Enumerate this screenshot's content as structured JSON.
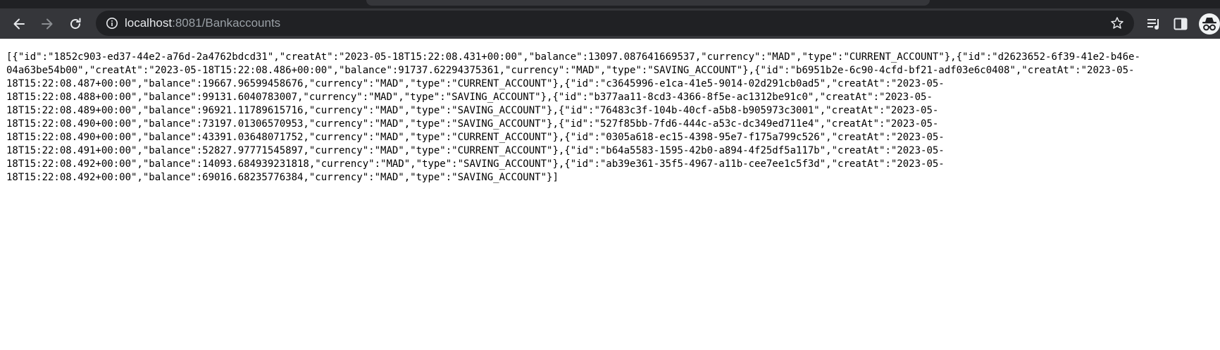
{
  "browser": {
    "url_host": "localhost",
    "url_rest": ":8081/Bankaccounts",
    "icons": {
      "back": "arrow-left-icon",
      "forward": "arrow-right-icon",
      "reload": "reload-icon",
      "site_info": "info-circle-icon",
      "bookmark": "star-icon",
      "media": "media-queue-icon",
      "side_panel": "side-panel-icon",
      "profile": "incognito-icon"
    },
    "colors": {
      "frame": "#202124",
      "toolbar": "#35363a",
      "omnibox": "#202124",
      "url_host": "#e8eaed",
      "url_rest": "#9aa0a6"
    }
  },
  "page": {
    "lines": [
      "[{\"id\":\"1852c903-ed37-44e2-a76d-2a4762bdcd31\",\"creatAt\":\"2023-05-18T15:22:08.431+00:00\",\"balance\":13097.087641669537,\"currency\":\"MAD\",\"type\":\"CURRENT_ACCOUNT\"},{\"id\":\"d2623652-6f39-41e2-b46e-",
      "04a63be54b00\",\"creatAt\":\"2023-05-18T15:22:08.486+00:00\",\"balance\":91737.62294375361,\"currency\":\"MAD\",\"type\":\"SAVING_ACCOUNT\"},{\"id\":\"b6951b2e-6c90-4cfd-bf21-adf03e6c0408\",\"creatAt\":\"2023-05-",
      "18T15:22:08.487+00:00\",\"balance\":19667.96599458676,\"currency\":\"MAD\",\"type\":\"CURRENT_ACCOUNT\"},{\"id\":\"c3645996-e1ca-41e5-9014-02d291cb0ad5\",\"creatAt\":\"2023-05-",
      "18T15:22:08.488+00:00\",\"balance\":99131.6040783007,\"currency\":\"MAD\",\"type\":\"SAVING_ACCOUNT\"},{\"id\":\"b377aa11-8cd3-4366-8f5e-ac1312be91c0\",\"creatAt\":\"2023-05-",
      "18T15:22:08.489+00:00\",\"balance\":96921.11789615716,\"currency\":\"MAD\",\"type\":\"SAVING_ACCOUNT\"},{\"id\":\"76483c3f-104b-40cf-a5b8-b905973c3001\",\"creatAt\":\"2023-05-",
      "18T15:22:08.490+00:00\",\"balance\":73197.01306570953,\"currency\":\"MAD\",\"type\":\"SAVING_ACCOUNT\"},{\"id\":\"527f85bb-7fd6-444c-a53c-dc349ed711e4\",\"creatAt\":\"2023-05-",
      "18T15:22:08.490+00:00\",\"balance\":43391.03648071752,\"currency\":\"MAD\",\"type\":\"CURRENT_ACCOUNT\"},{\"id\":\"0305a618-ec15-4398-95e7-f175a799c526\",\"creatAt\":\"2023-05-",
      "18T15:22:08.491+00:00\",\"balance\":52827.97771545897,\"currency\":\"MAD\",\"type\":\"CURRENT_ACCOUNT\"},{\"id\":\"b64a5583-1595-42b0-a894-4f25df5a117b\",\"creatAt\":\"2023-05-",
      "18T15:22:08.492+00:00\",\"balance\":14093.684939231818,\"currency\":\"MAD\",\"type\":\"SAVING_ACCOUNT\"},{\"id\":\"ab39e361-35f5-4967-a11b-cee7ee1c5f3d\",\"creatAt\":\"2023-05-",
      "18T15:22:08.492+00:00\",\"balance\":69016.68235776384,\"currency\":\"MAD\",\"type\":\"SAVING_ACCOUNT\"}]"
    ]
  }
}
